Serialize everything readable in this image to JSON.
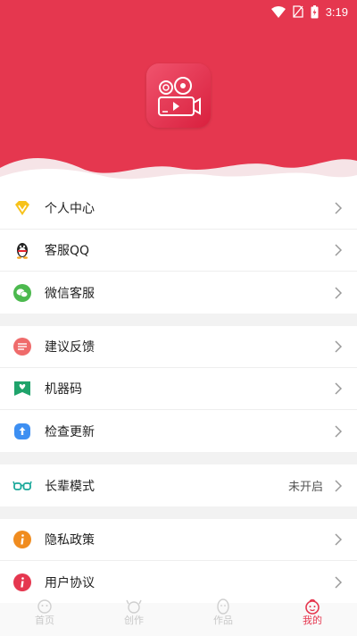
{
  "status": {
    "time": "3:19"
  },
  "colors": {
    "primary": "#e5374f",
    "text": "#222222",
    "muted": "#555555",
    "inactive_tab": "#c8c8c8"
  },
  "groups": [
    [
      {
        "label": "个人中心",
        "icon": "vip-diamond-icon"
      },
      {
        "label": "客服QQ",
        "icon": "qq-penguin-icon"
      },
      {
        "label": "微信客服",
        "icon": "wechat-icon"
      }
    ],
    [
      {
        "label": "建议反馈",
        "icon": "feedback-bubble-icon"
      },
      {
        "label": "机器码",
        "icon": "machine-code-icon"
      },
      {
        "label": "检查更新",
        "icon": "update-icon"
      }
    ],
    [
      {
        "label": "长辈模式",
        "icon": "glasses-icon",
        "value": "未开启"
      }
    ],
    [
      {
        "label": "隐私政策",
        "icon": "info-circle-icon"
      },
      {
        "label": "用户协议",
        "icon": "info-circle-red-icon"
      }
    ]
  ],
  "tabs": [
    {
      "label": "首页",
      "icon": "home-icon",
      "active": false
    },
    {
      "label": "创作",
      "icon": "create-icon",
      "active": false
    },
    {
      "label": "作品",
      "icon": "works-icon",
      "active": false
    },
    {
      "label": "我的",
      "icon": "profile-face-icon",
      "active": true
    }
  ]
}
